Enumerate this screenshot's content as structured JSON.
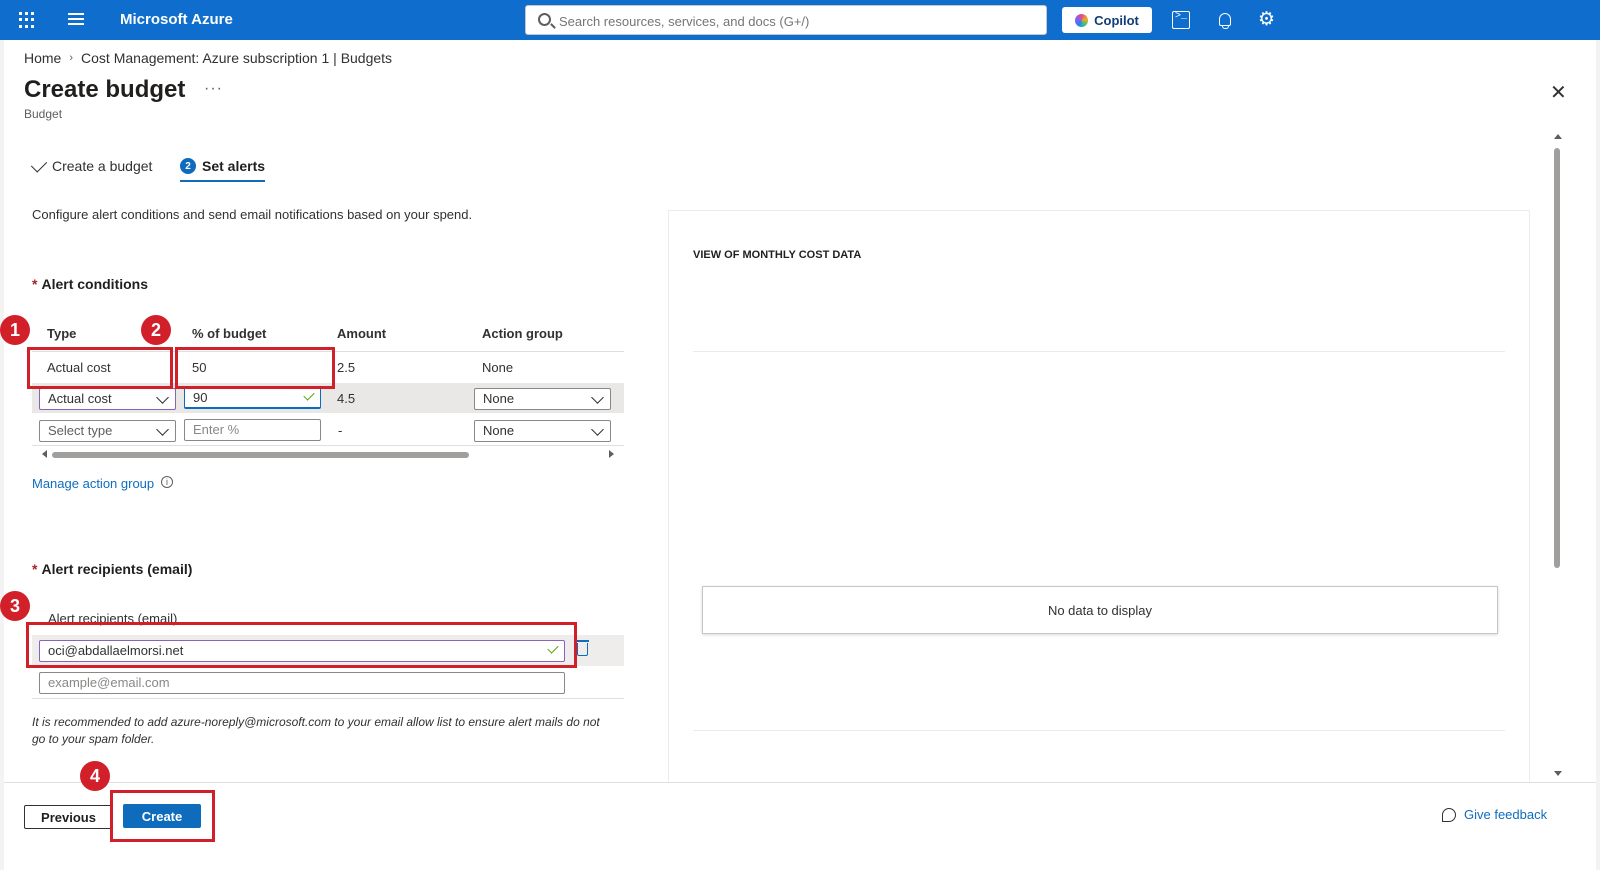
{
  "topbar": {
    "brand": "Microsoft Azure",
    "search_placeholder": "Search resources, services, and docs (G+/)",
    "copilot_label": "Copilot"
  },
  "breadcrumb": {
    "home": "Home",
    "current": "Cost Management: Azure subscription 1 | Budgets"
  },
  "header": {
    "title": "Create budget",
    "more": "···",
    "subtitle": "Budget",
    "close": "✕"
  },
  "tabs": [
    {
      "label": "Create a budget",
      "state": "done"
    },
    {
      "label": "Set alerts",
      "step": "2",
      "state": "active"
    }
  ],
  "description": "Configure alert conditions and send email notifications based on your spend.",
  "alert_conditions": {
    "heading": "Alert conditions",
    "required_mark": "*",
    "columns": [
      "Type",
      "% of budget",
      "Amount",
      "Action group"
    ],
    "rows": [
      {
        "type": "Actual cost",
        "percent": "50",
        "amount": "2.5",
        "action_group": "None"
      },
      {
        "type": "Actual cost",
        "percent": "90",
        "amount": "4.5",
        "action_group": "None"
      },
      {
        "type_placeholder": "Select type",
        "percent_placeholder": "Enter %",
        "amount": "-",
        "action_group": "None"
      }
    ],
    "manage_link": "Manage action group",
    "info_icon": "i"
  },
  "alert_recipients": {
    "heading": "Alert recipients (email)",
    "required_mark": "*",
    "column": "Alert recipients (email)",
    "email": "oci@abdallaelmorsi.net",
    "placeholder": "example@email.com",
    "note": "It is recommended to add azure-noreply@microsoft.com to your email allow list to ensure alert mails do not go to your spam folder."
  },
  "panel": {
    "title": "VIEW OF MONTHLY COST DATA",
    "empty": "No data to display"
  },
  "footer": {
    "previous": "Previous",
    "create": "Create",
    "feedback": "Give feedback"
  },
  "annotations": [
    "1",
    "2",
    "3",
    "4"
  ],
  "colors": {
    "topbar": "#0f6ecd",
    "accent": "#0f6cbd",
    "highlight": "#d1202a",
    "required": "#a4262c"
  }
}
